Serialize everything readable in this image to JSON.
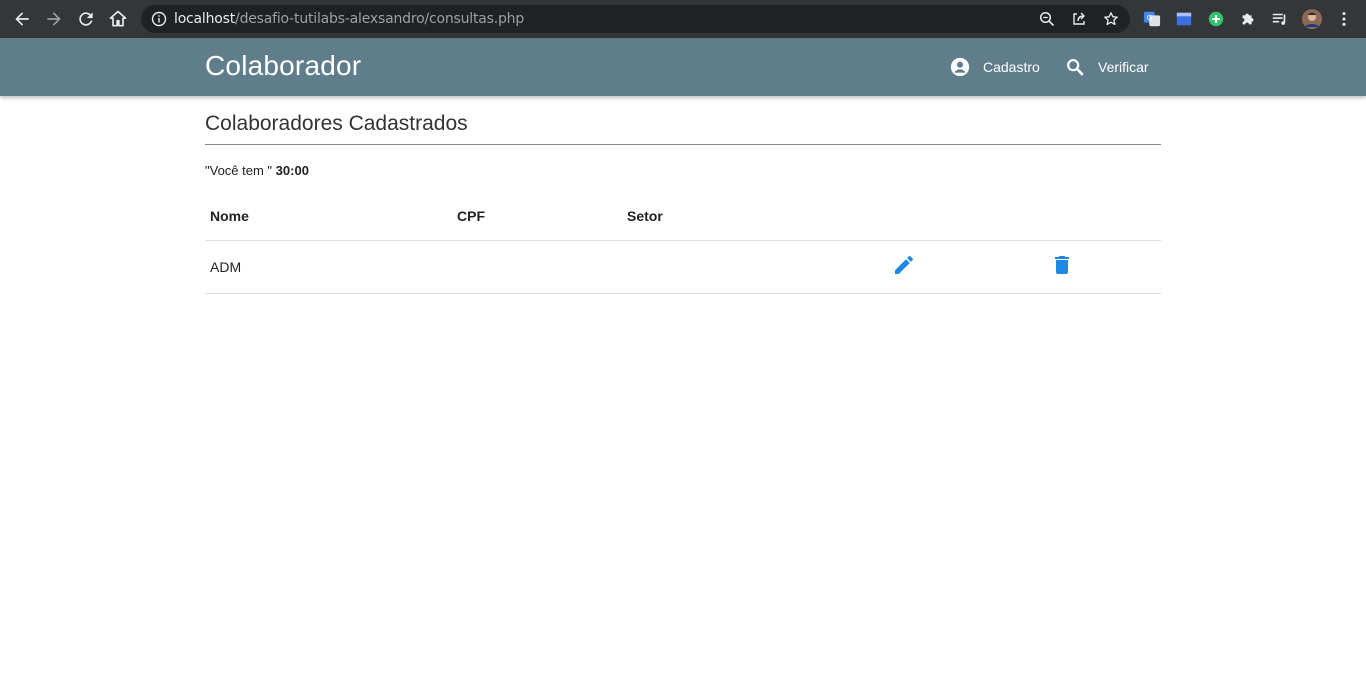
{
  "browser": {
    "url_host": "localhost",
    "url_path": "/desafio-tutilabs-alexsandro/consultas.php"
  },
  "header": {
    "brand": "Colaborador",
    "nav": [
      {
        "label": "Cadastro",
        "icon": "account-circle-icon"
      },
      {
        "label": "Verificar",
        "icon": "search-icon"
      }
    ]
  },
  "main": {
    "title": "Colaboradores Cadastrados",
    "timer_prefix": "\"Você tem \"",
    "timer_value": "30:00",
    "table": {
      "headers": [
        "Nome",
        "CPF",
        "Setor"
      ],
      "rows": [
        {
          "nome": "ADM",
          "cpf": "",
          "setor": ""
        }
      ],
      "actions": [
        "edit-icon",
        "delete-icon"
      ]
    }
  },
  "colors": {
    "header_bg": "#607d8b",
    "action_icon": "#1e88e5",
    "browser_bar": "#35363a"
  }
}
